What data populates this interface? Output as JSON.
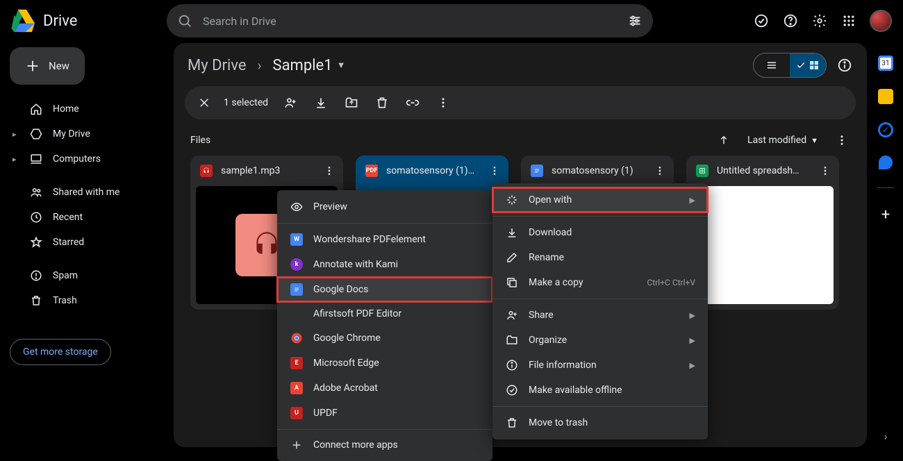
{
  "app": {
    "name": "Drive"
  },
  "search": {
    "placeholder": "Search in Drive"
  },
  "sidebar": {
    "new_label": "New",
    "items": [
      {
        "label": "Home"
      },
      {
        "label": "My Drive"
      },
      {
        "label": "Computers"
      },
      {
        "label": "Shared with me"
      },
      {
        "label": "Recent"
      },
      {
        "label": "Starred"
      },
      {
        "label": "Spam"
      },
      {
        "label": "Trash"
      }
    ],
    "storage_label": "Get more storage"
  },
  "breadcrumb": {
    "root": "My Drive",
    "current": "Sample1"
  },
  "selection": {
    "count_label": "1 selected"
  },
  "files_section": {
    "heading": "Files",
    "sort_label": "Last modified"
  },
  "files": [
    {
      "name": "sample1.mp3"
    },
    {
      "name": "somatosensory (1)…"
    },
    {
      "name": "somatosensory (1)"
    },
    {
      "name": "Untitled spreadsh…"
    }
  ],
  "openwith_menu": {
    "preview": "Preview",
    "items": [
      "Wondershare PDFelement",
      "Annotate with Kami",
      "Google Docs",
      "Afirstsoft PDF Editor",
      "Google Chrome",
      "Microsoft Edge",
      "Adobe Acrobat",
      "UPDF"
    ],
    "connect": "Connect more apps"
  },
  "main_menu": {
    "open_with": "Open with",
    "download": "Download",
    "rename": "Rename",
    "make_copy": "Make a copy",
    "make_copy_shortcut": "Ctrl+C Ctrl+V",
    "share": "Share",
    "organize": "Organize",
    "file_info": "File information",
    "offline": "Make available offline",
    "trash": "Move to trash"
  }
}
